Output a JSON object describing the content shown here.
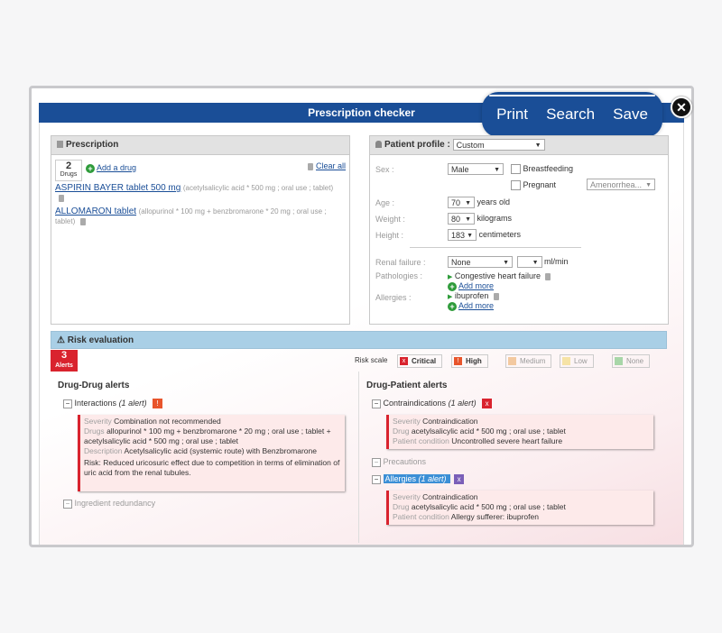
{
  "topbar": {
    "print": "Print",
    "search": "Search",
    "save": "Save",
    "close": "✕"
  },
  "window": {
    "title": "Prescription checker"
  },
  "prescription": {
    "header": "Prescription",
    "drug_count": "2",
    "drug_count_label": "Drugs",
    "add_drug": "Add a drug",
    "clear_all": "Clear all",
    "items": [
      {
        "name": "ASPIRIN BAYER tablet 500 mg",
        "detail": "(acetylsalicylic acid * 500 mg ; oral use ; tablet)"
      },
      {
        "name": "ALLOMARON tablet",
        "detail": "(allopurinol * 100 mg + benzbromarone * 20 mg ; oral use ; tablet)"
      }
    ]
  },
  "profile": {
    "header": "Patient profile :",
    "profile_value": "Custom",
    "sex_label": "Sex :",
    "sex_value": "Male",
    "breastfeeding": "Breastfeeding",
    "pregnant": "Pregnant",
    "amenorrhea": "Amenorrhea...",
    "age_label": "Age :",
    "age_value": "70",
    "age_unit": "years old",
    "weight_label": "Weight :",
    "weight_value": "80",
    "weight_unit": "kilograms",
    "height_label": "Height :",
    "height_value": "183",
    "height_unit": "centimeters",
    "renal_label": "Renal failure :",
    "renal_value": "None",
    "renal_unit": "ml/min",
    "pathologies_label": "Pathologies :",
    "pathology_item": "Congestive heart failure",
    "add_more": "Add more",
    "allergies_label": "Allergies :",
    "allergy_item": "ibuprofen",
    "add_more2": "Add more"
  },
  "risk": {
    "header": "Risk evaluation",
    "alerts_count": "3",
    "alerts_label": "Alerts",
    "scale_label": "Risk scale",
    "scale": [
      {
        "label": "Critical",
        "color": "#d9232e"
      },
      {
        "label": "High",
        "color": "#e8552c"
      },
      {
        "label": "Medium",
        "color": "#f3c9a0"
      },
      {
        "label": "Low",
        "color": "#f6e3a6"
      },
      {
        "label": "None",
        "color": "#a8d6a8"
      }
    ]
  },
  "drug_drug": {
    "title": "Drug-Drug alerts",
    "interactions": "Interactions",
    "interactions_count": "(1 alert)",
    "severity_label": "Severity",
    "severity_value": "Combination not recommended",
    "drugs_label": "Drugs",
    "drugs_value": "allopurinol * 100 mg + benzbromarone * 20 mg ; oral use ; tablet + acetylsalicylic acid * 500 mg ; oral use ; tablet",
    "description_label": "Description",
    "description_value": "Acetylsalicylic acid (systemic route) with Benzbromarone",
    "risk_label": "Risk:",
    "risk_value": "Reduced uricosuric effect due to competition in terms of elimination of uric acid from the renal tubules.",
    "ingredient_redundancy": "Ingredient redundancy"
  },
  "drug_patient": {
    "title": "Drug-Patient alerts",
    "contraindications": "Contraindications",
    "contra_count": "(1 alert)",
    "c_severity_label": "Severity",
    "c_severity_value": "Contraindication",
    "c_drug_label": "Drug",
    "c_drug_value": "acetylsalicylic acid * 500 mg ; oral use ; tablet",
    "c_condition_label": "Patient condition",
    "c_condition_value": "Uncontrolled severe heart failure",
    "precautions": "Precautions",
    "allergies": "Allergies",
    "allergies_count": "(1 alert)",
    "a_severity_label": "Severity",
    "a_severity_value": "Contraindication",
    "a_drug_label": "Drug",
    "a_drug_value": "acetylsalicylic acid * 500 mg ; oral use ; tablet",
    "a_condition_label": "Patient condition",
    "a_condition_value": "Allergy sufferer: ibuprofen"
  }
}
